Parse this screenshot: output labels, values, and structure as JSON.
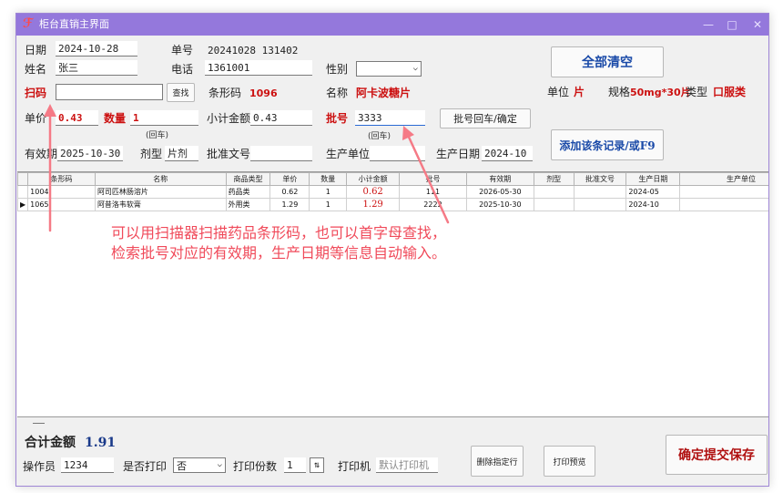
{
  "window": {
    "title": "柜台直销主界面",
    "min": "—",
    "max": "□",
    "close": "✕"
  },
  "form": {
    "date_label": "日期",
    "date_value": "2024-10-28",
    "order_no_label": "单号",
    "order_no_value": "20241028 131402",
    "name_label": "姓名",
    "name_value": "张三",
    "phone_label": "电话",
    "phone_value": "1361001",
    "gender_label": "性别",
    "gender_value": "",
    "scan_label": "扫码",
    "scan_value": "",
    "search_button": "查找",
    "barcode_label": "条形码",
    "barcode_value": "1096",
    "name2_label": "名称",
    "name2_value": "阿卡波糖片",
    "unit_label": "单位",
    "unit_value": "片",
    "spec_label": "规格",
    "spec_value": "50mg*30片",
    "type_label": "类型",
    "type_value": "口服类",
    "price_label": "单价",
    "price_value": "0.43",
    "qty_label": "数量",
    "qty_value": "1",
    "enter_hint_qty": "(回车)",
    "subtotal_label": "小计金额",
    "subtotal_value": "0.43",
    "batch_label": "批号",
    "batch_value": "3333",
    "enter_hint_batch": "(回车)",
    "batch_confirm_button": "批号回车/确定",
    "expiry_label": "有效期",
    "expiry_value": "2025-10-30",
    "dosage_label": "剂型",
    "dosage_value": "片剂",
    "approval_label": "批准文号",
    "approval_value": "",
    "maker_label": "生产单位",
    "maker_value": "",
    "prod_date_label": "生产日期",
    "prod_date_value": "2024-10",
    "clear_all_button": "全部清空",
    "add_record_button": "添加该条记录/或F9"
  },
  "grid": {
    "columns": [
      "条形码",
      "名称",
      "商品类型",
      "单价",
      "数量",
      "小计金额",
      "批号",
      "有效期",
      "剂型",
      "批准文号",
      "生产日期",
      "生产单位"
    ],
    "rows": [
      {
        "marker": "",
        "cells": [
          "1004",
          "阿司匹林肠溶片",
          "药品类",
          "0.62",
          "1",
          "0.62",
          "111",
          "2026-05-30",
          "",
          "",
          "2024-05",
          ""
        ]
      },
      {
        "marker": "▶",
        "cells": [
          "1065",
          "阿昔洛韦软膏",
          "外用类",
          "1.29",
          "1",
          "1.29",
          "2222",
          "2025-10-30",
          "",
          "",
          "2024-10",
          ""
        ]
      }
    ]
  },
  "annotation": {
    "line1": "可以用扫描器扫描药品条形码，也可以首字母查找，",
    "line2": "检索批号对应的有效期，生产日期等信息自动输入。"
  },
  "footer": {
    "total_label": "合计金额",
    "total_value": "1.91",
    "operator_label": "操作员",
    "operator_value": "1234",
    "print_label": "是否打印",
    "print_value": "否",
    "copies_label": "打印份数",
    "copies_value": "1",
    "printer_label": "打印机",
    "printer_placeholder": "默认打印机",
    "delete_row_button": "删除指定行",
    "print_preview_button": "打印预览",
    "submit_button": "确定提交保存"
  },
  "colors": {
    "titlebar": "#9478dc",
    "accent_red": "#cc1111",
    "annotation": "#f04a5a"
  }
}
